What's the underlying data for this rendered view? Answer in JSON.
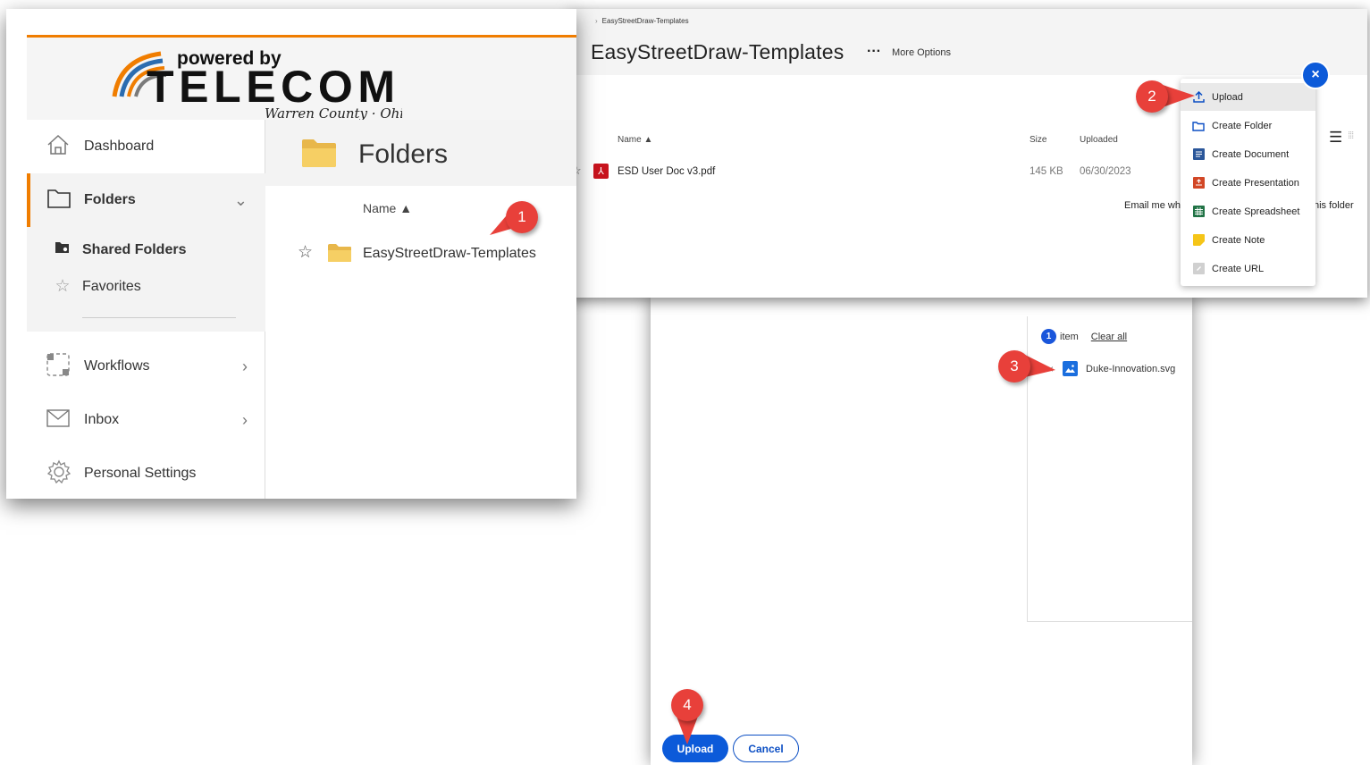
{
  "breadcrumb": {
    "current": "EasyStreetDraw-Templates"
  },
  "folder_view": {
    "title": "EasyStreetDraw-Templates",
    "more_options": "More Options",
    "columns": {
      "name": "Name ▲",
      "size": "Size",
      "uploaded": "Uploaded"
    },
    "file": {
      "name": "ESD User Doc v3.pdf",
      "size": "145 KB",
      "uploaded": "06/30/2023"
    },
    "email_text": "Email me wh",
    "folder_text": "his folder"
  },
  "create_menu": {
    "items": [
      {
        "label": "Upload",
        "icon": "upload-icon"
      },
      {
        "label": "Create Folder",
        "icon": "folder-outline-icon"
      },
      {
        "label": "Create Document",
        "icon": "document-icon"
      },
      {
        "label": "Create Presentation",
        "icon": "presentation-icon"
      },
      {
        "label": "Create Spreadsheet",
        "icon": "spreadsheet-icon"
      },
      {
        "label": "Create Note",
        "icon": "note-icon"
      },
      {
        "label": "Create URL",
        "icon": "link-icon"
      }
    ],
    "close": "×"
  },
  "upload_dialog": {
    "item_count": "1",
    "item_label": "item",
    "clear_all": "Clear all",
    "remove": "×",
    "file_name": "Duke-Innovation.svg",
    "upload_button": "Upload",
    "cancel_button": "Cancel"
  },
  "app": {
    "logo": {
      "top": "powered by",
      "main": "TELECOM",
      "sub": "Warren County · Ohio"
    },
    "nav": [
      {
        "label": "Dashboard",
        "icon": "home-icon"
      },
      {
        "label": "Folders",
        "icon": "folder-outline-icon"
      },
      {
        "label": "Workflows",
        "icon": "workflow-icon"
      },
      {
        "label": "Inbox",
        "icon": "mail-icon"
      },
      {
        "label": "Personal Settings",
        "icon": "gear-icon"
      }
    ],
    "subnav": [
      {
        "label": "Shared Folders",
        "icon": "shared-folder-icon"
      },
      {
        "label": "Favorites",
        "icon": "star-icon"
      }
    ],
    "main": {
      "title": "Folders",
      "column_name": "Name ▲",
      "folder_name": "EasyStreetDraw-Templates"
    }
  },
  "callouts": [
    "1",
    "2",
    "3",
    "4"
  ],
  "colors": {
    "accent_orange": "#f07d00",
    "primary_blue": "#0c5ad9",
    "callout_red": "#e8403a"
  }
}
